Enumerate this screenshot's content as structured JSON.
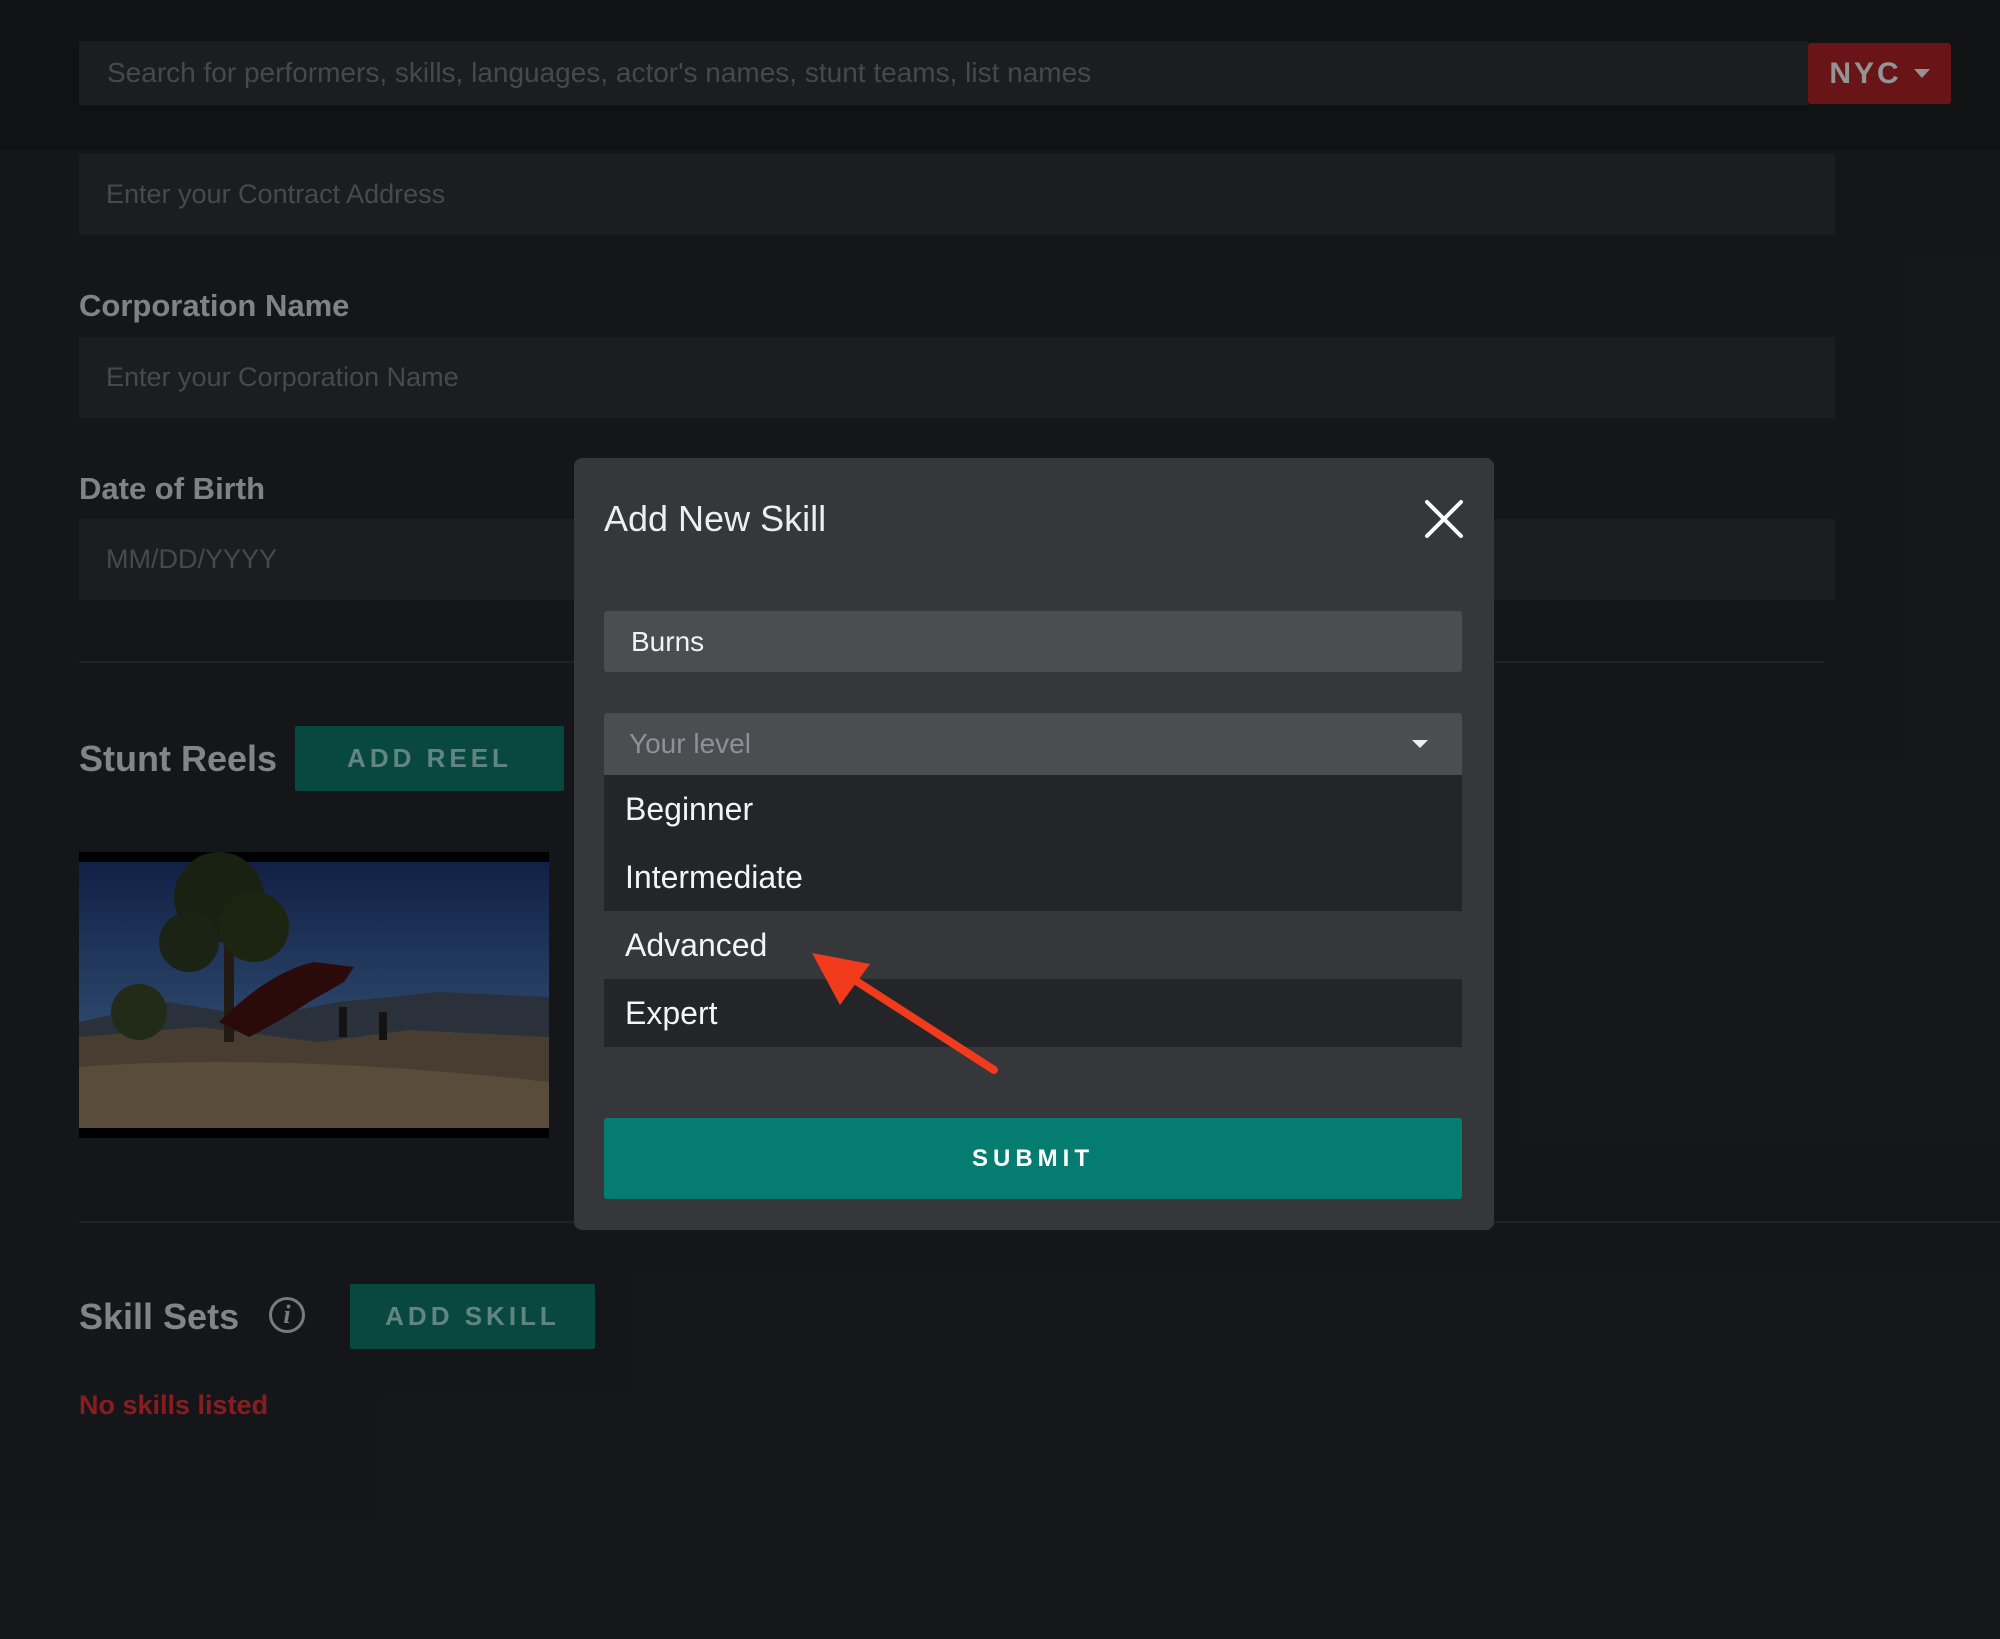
{
  "header": {
    "search_placeholder": "Search for performers, skills, languages, actor's names, stunt teams, list names",
    "city_label": "NYC"
  },
  "form": {
    "contract_address_placeholder": "Enter your Contract Address",
    "corporation_label": "Corporation Name",
    "corporation_placeholder": "Enter your Corporation Name",
    "dob_label": "Date of Birth",
    "dob_placeholder": "MM/DD/YYYY"
  },
  "stunt_reels": {
    "title": "Stunt Reels",
    "add_label": "ADD REEL"
  },
  "skill_sets": {
    "title": "Skill Sets",
    "info_glyph": "i",
    "add_label": "ADD SKILL",
    "empty_message": "No skills listed"
  },
  "modal": {
    "title": "Add New Skill",
    "skill_value": "Burns",
    "level_placeholder": "Your level",
    "level_options": [
      "Beginner",
      "Intermediate",
      "Advanced",
      "Expert"
    ],
    "highlighted_option": "Advanced",
    "submit_label": "SUBMIT"
  },
  "colors": {
    "accent_teal": "#057c70",
    "city_red": "#b52426",
    "annotation_arrow": "#f23a1d"
  }
}
